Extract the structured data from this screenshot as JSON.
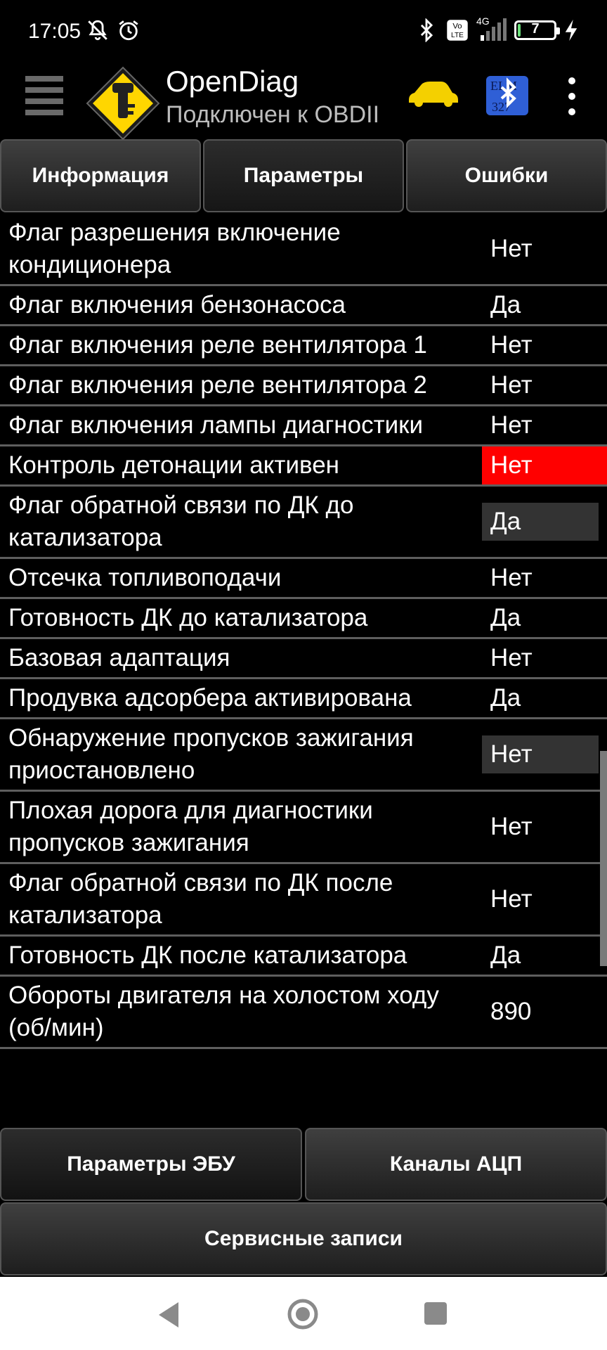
{
  "status_bar": {
    "time": "17:05",
    "battery_level": "7",
    "network": "4G",
    "icons": [
      "mute-notifications-icon",
      "alarm-icon",
      "bluetooth-icon",
      "volte-icon",
      "signal-icon",
      "battery-icon",
      "charging-icon"
    ]
  },
  "app_bar": {
    "title": "OpenDiag",
    "subtitle": "Подключен к OBDII"
  },
  "tabs": [
    {
      "label": "Информация"
    },
    {
      "label": "Параметры"
    },
    {
      "label": "Ошибки"
    }
  ],
  "parameters": [
    {
      "name": "Флаг разрешения включение кондиционера",
      "value": "Нет",
      "highlight": ""
    },
    {
      "name": "Флаг включения бензонасоса",
      "value": "Да",
      "highlight": ""
    },
    {
      "name": "Флаг включения реле вентилятора 1",
      "value": "Нет",
      "highlight": ""
    },
    {
      "name": "Флаг включения реле вентилятора 2",
      "value": "Нет",
      "highlight": ""
    },
    {
      "name": "Флаг включения лампы диагностики",
      "value": "Нет",
      "highlight": ""
    },
    {
      "name": "Контроль детонации активен",
      "value": "Нет",
      "highlight": "red"
    },
    {
      "name": "Флаг обратной связи по ДК до катализатора",
      "value": "Да",
      "highlight": "dark"
    },
    {
      "name": "Отсечка топливоподачи",
      "value": "Нет",
      "highlight": ""
    },
    {
      "name": "Готовность ДК до катализатора",
      "value": "Да",
      "highlight": ""
    },
    {
      "name": "Базовая адаптация",
      "value": "Нет",
      "highlight": ""
    },
    {
      "name": "Продувка адсорбера активирована",
      "value": "Да",
      "highlight": ""
    },
    {
      "name": "Обнаружение пропусков зажигания приостановлено",
      "value": "Нет",
      "highlight": "dark"
    },
    {
      "name": "Плохая дорога для диагностики пропусков зажигания",
      "value": "Нет",
      "highlight": ""
    },
    {
      "name": "Флаг обратной связи по ДК после катализатора",
      "value": "Нет",
      "highlight": ""
    },
    {
      "name": "Готовность ДК после катализатора",
      "value": "Да",
      "highlight": ""
    },
    {
      "name": "Обороты двигателя на холостом ходу (об/мин)",
      "value": "890",
      "highlight": ""
    }
  ],
  "bottom_buttons": {
    "ecu_params": "Параметры ЭБУ",
    "adc_channels": "Каналы АЦП",
    "service_records": "Сервисные записи"
  },
  "colors": {
    "highlight_red": "#ff0000",
    "highlight_dark": "#333333",
    "logo_yellow": "#ffd600",
    "car_yellow": "#f4d000",
    "bt_blue": "#2f5fd6"
  }
}
